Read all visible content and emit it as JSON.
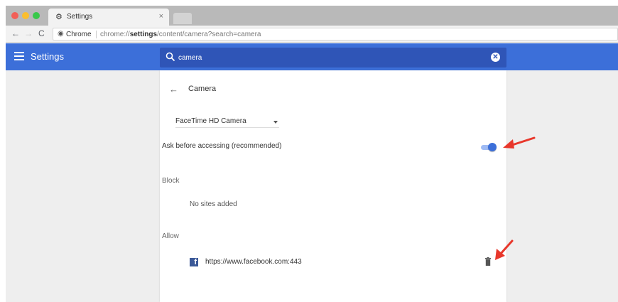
{
  "browser": {
    "tab": {
      "title": "Settings",
      "icon": "gear-icon",
      "close": "×"
    },
    "nav": {
      "back": "←",
      "forward": "→",
      "reload": "C"
    },
    "omnibox": {
      "site_label": "Chrome",
      "url_prefix": "chrome://",
      "url_host": "settings",
      "url_path": "/content/camera?search=camera"
    }
  },
  "header": {
    "title": "Settings"
  },
  "search": {
    "value": "camera",
    "clear": "✕"
  },
  "camera": {
    "back": "←",
    "title": "Camera",
    "device_select": {
      "value": "FaceTime HD Camera"
    },
    "ask_label": "Ask before accessing (recommended)",
    "ask_enabled": true,
    "block": {
      "title": "Block",
      "empty_text": "No sites added"
    },
    "allow": {
      "title": "Allow",
      "sites": [
        {
          "icon": "facebook-icon",
          "icon_glyph": "f",
          "url": "https://www.facebook.com:443"
        }
      ]
    }
  },
  "colors": {
    "accent": "#3c6fd9",
    "search_bg": "#2f55b7",
    "annotation": "#e8372b",
    "facebook": "#3b5998"
  }
}
